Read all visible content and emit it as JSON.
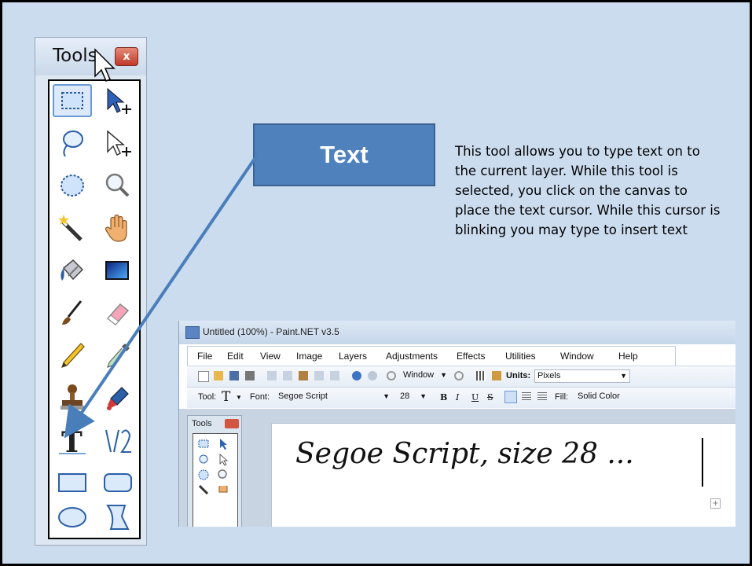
{
  "tools_window": {
    "title": "Tools",
    "close_glyph": "x",
    "tools": [
      {
        "name": "rectangle-select-icon",
        "selected": true
      },
      {
        "name": "move-selected-pixels-icon"
      },
      {
        "name": "lasso-select-icon"
      },
      {
        "name": "move-selection-icon"
      },
      {
        "name": "ellipse-select-icon"
      },
      {
        "name": "zoom-icon"
      },
      {
        "name": "magic-wand-icon"
      },
      {
        "name": "pan-hand-icon"
      },
      {
        "name": "paint-bucket-icon"
      },
      {
        "name": "gradient-icon"
      },
      {
        "name": "paintbrush-icon"
      },
      {
        "name": "eraser-icon"
      },
      {
        "name": "pencil-icon"
      },
      {
        "name": "color-picker-icon"
      },
      {
        "name": "clone-stamp-icon"
      },
      {
        "name": "recolor-icon"
      },
      {
        "name": "text-tool-icon"
      },
      {
        "name": "line-curve-icon"
      },
      {
        "name": "rectangle-shape-icon"
      },
      {
        "name": "rounded-rectangle-icon"
      },
      {
        "name": "ellipse-shape-icon"
      },
      {
        "name": "freeform-shape-icon"
      }
    ]
  },
  "callout": {
    "label": "Text",
    "description": "This tool allows you to type text on to the current layer. While this tool is selected, you click on the canvas to place the text cursor. While this cursor is blinking you may type to insert text"
  },
  "app": {
    "title": "Untitled (100%) - Paint.NET v3.5",
    "menu": [
      "File",
      "Edit",
      "View",
      "Image",
      "Layers",
      "Adjustments",
      "Effects",
      "Utilities",
      "Window",
      "Help"
    ],
    "toolbar1": {
      "zoom_value": "Window",
      "units_label": "Units:",
      "units_value": "Pixels"
    },
    "toolbar2": {
      "tool_label": "Tool:",
      "tool_glyph": "T",
      "font_label": "Font:",
      "font_value": "Segoe Script",
      "size_value": "28",
      "bold": "B",
      "italic": "I",
      "underline": "U",
      "strike": "S",
      "fill_label": "Fill:",
      "fill_value": "Solid Color"
    },
    "mini_tools_title": "Tools",
    "canvas_text": "Segoe Script, size 28 ..."
  },
  "colors": {
    "slide_bg": "#ccdcef",
    "callout_fill": "#4f81bd",
    "arrow": "#4a7ebb"
  }
}
